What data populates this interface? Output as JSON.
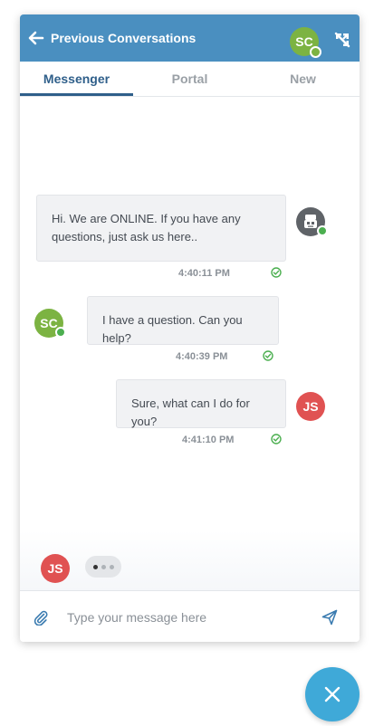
{
  "header": {
    "title": "Previous Conversations",
    "avatar_initials": "SC",
    "color": "#4a8fc0"
  },
  "tabs": [
    {
      "label": "Messenger",
      "active": true
    },
    {
      "label": "Portal",
      "active": false
    },
    {
      "label": "New",
      "active": false
    }
  ],
  "messages": [
    {
      "sender": "bot",
      "text": "Hi. We are ONLINE. If you have any questions, just ask us here..",
      "time": "4:40:11 PM",
      "status": "delivered"
    },
    {
      "sender": "SC",
      "text": "I have a question. Can you help?",
      "time": "4:40:39 PM",
      "status": "delivered"
    },
    {
      "sender": "JS",
      "text": "Sure, what can I do for you?",
      "time": "4:41:10 PM",
      "status": "delivered"
    }
  ],
  "participants": {
    "sc": {
      "initials": "SC",
      "color": "#7cb342"
    },
    "js": {
      "initials": "JS",
      "color": "#e05252"
    },
    "bot": {
      "icon": "robot-icon",
      "color": "#5f6368"
    }
  },
  "typing": {
    "initials": "JS"
  },
  "composer": {
    "placeholder": "Type your message here",
    "attach_icon": "paperclip-icon",
    "send_icon": "send-icon"
  },
  "fab": {
    "icon": "close-icon",
    "color": "#3fa9d8"
  },
  "colors": {
    "status_ok": "#4caf50",
    "accent": "#2f5f8a"
  }
}
